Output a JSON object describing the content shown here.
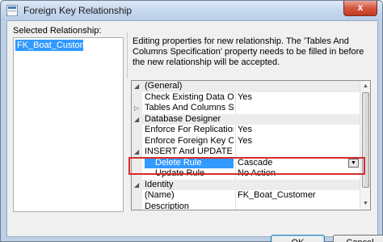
{
  "window": {
    "title": "Foreign Key Relationship",
    "close_glyph": "x"
  },
  "left_panel": {
    "label": "Selected Relationship:",
    "items": [
      {
        "label": "FK_Boat_Customer*",
        "selected": true
      }
    ]
  },
  "info": {
    "text": "Editing properties for new relationship.  The 'Tables And Columns Specification' property needs to be filled in before the new relationship will be accepted."
  },
  "grid": {
    "rows": [
      {
        "type": "category",
        "glyph": "◢",
        "name": "(General)"
      },
      {
        "type": "property",
        "glyph": "",
        "name": "Check Existing Data On Creati",
        "value": "Yes"
      },
      {
        "type": "property",
        "glyph": "▷",
        "name": "Tables And Columns Specific",
        "value": ""
      },
      {
        "type": "category",
        "glyph": "◢",
        "name": "Database Designer"
      },
      {
        "type": "property",
        "glyph": "",
        "name": "Enforce For Replication",
        "value": "Yes"
      },
      {
        "type": "property",
        "glyph": "",
        "name": "Enforce Foreign Key Constrair",
        "value": "Yes"
      },
      {
        "type": "property",
        "glyph": "◢",
        "name": "INSERT And UPDATE Specific",
        "value": ""
      },
      {
        "type": "property",
        "glyph": "",
        "name": "Delete Rule",
        "value": "Cascade",
        "selected": true,
        "dropdown": true,
        "indent": true
      },
      {
        "type": "property",
        "glyph": "",
        "name": "Update Rule",
        "value": "No Action",
        "indent": true
      },
      {
        "type": "category",
        "glyph": "◢",
        "name": "Identity"
      },
      {
        "type": "property",
        "glyph": "",
        "name": "(Name)",
        "value": "FK_Boat_Customer"
      },
      {
        "type": "property",
        "glyph": "",
        "name": "Description",
        "value": ""
      }
    ],
    "dropdown_glyph": "▼",
    "scroll_up_glyph": "▲",
    "scroll_down_glyph": "▼"
  },
  "buttons": {
    "ok_label": "OK",
    "cancel_label": "Cancel"
  },
  "colors": {
    "selection": "#3399ff",
    "highlight_border": "#d92b2b"
  }
}
